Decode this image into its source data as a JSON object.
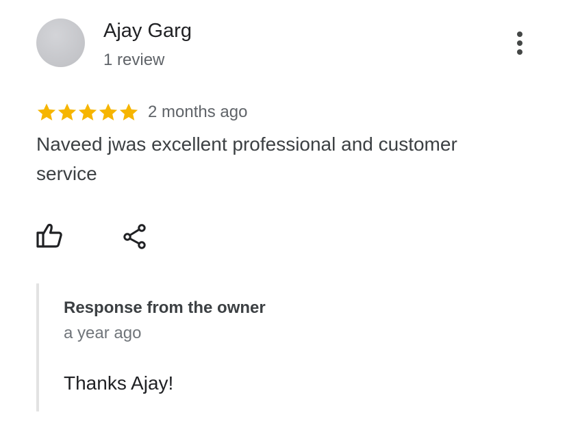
{
  "reviewer": {
    "name": "Ajay Garg",
    "review_count": "1 review",
    "avatar_icon": "avatar-placeholder"
  },
  "review": {
    "rating": 5,
    "rating_max": 5,
    "star_color": "#F6B500",
    "date": "2 months ago",
    "text": "Naveed jwas excellent professional and customer service"
  },
  "actions": {
    "like_icon": "thumbs-up-icon",
    "share_icon": "share-icon",
    "more_icon": "more-vertical-icon"
  },
  "owner_response": {
    "title": "Response from the owner",
    "date": "a year ago",
    "text": "Thanks Ajay!"
  }
}
